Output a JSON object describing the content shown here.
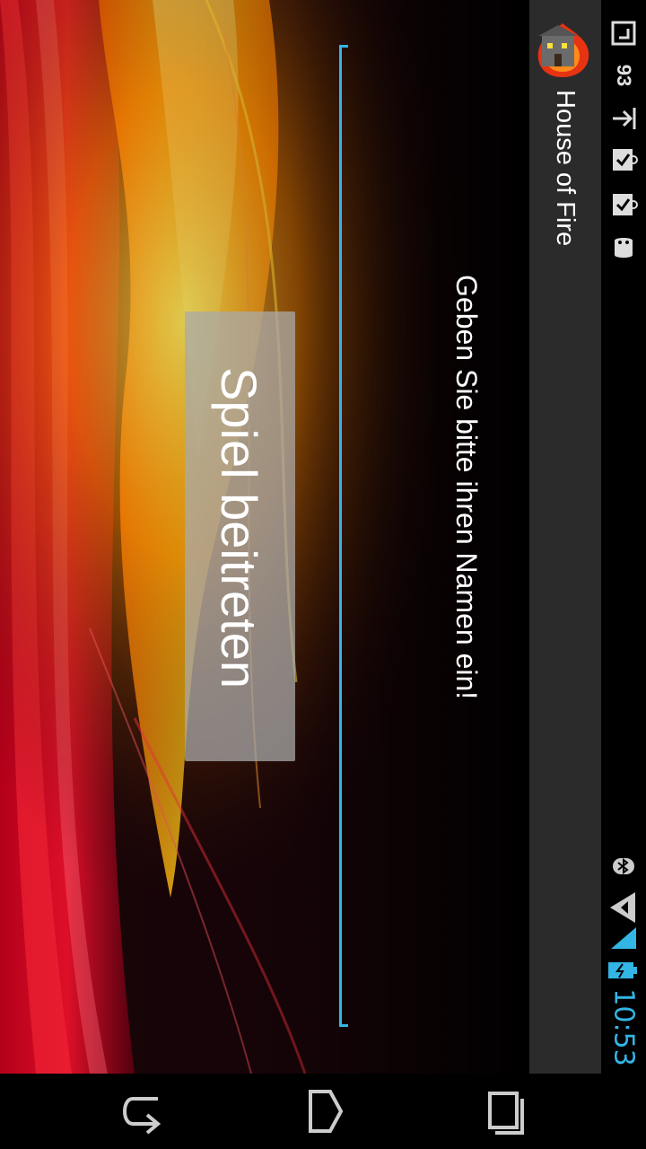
{
  "app": {
    "title": "House of Fire"
  },
  "status_bar": {
    "time": "10:53",
    "badge_number": "93"
  },
  "form": {
    "prompt": "Geben Sie bitte ihren Namen ein!",
    "name_value": "",
    "join_label": "Spiel beitreten"
  },
  "colors": {
    "accent": "#33b5e5",
    "action_bar": "#2b2b2b",
    "button": "#aaaaaa"
  },
  "icons": {
    "app": "house-fire-icon",
    "nav": [
      "rotate-icon",
      "home-icon",
      "recent-apps-icon"
    ]
  }
}
